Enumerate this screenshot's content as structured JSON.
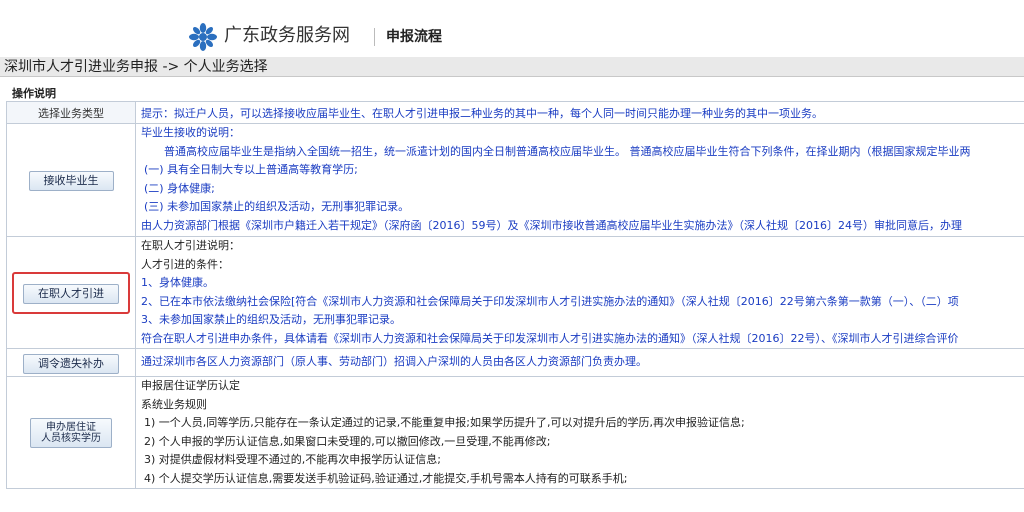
{
  "header": {
    "site_name": "广东政务服务网",
    "page_title": "申报流程"
  },
  "breadcrumb": "深圳市人才引进业务申报 -> 个人业务选择",
  "section_title": "操作说明",
  "table": {
    "head": {
      "left": "选择业务类型",
      "right": "提示：拟迁户人员，可以选择接收应届毕业生、在职人才引进申报二种业务的其中一种，每个人同一时间只能办理一种业务的其中一项业务。"
    },
    "rows": [
      {
        "button": "接收毕业生",
        "lines": [
          {
            "text": "毕业生接收的说明：",
            "cls": ""
          },
          {
            "text": "普通高校应届毕业生是指纳入全国统一招生，统一派遣计划的国内全日制普通高校应届毕业生。 普通高校应届毕业生符合下列条件，在择业期内（根据国家规定毕业两",
            "cls": "ind"
          },
          {
            "text": "(一) 具有全日制大专以上普通高等教育学历;",
            "cls": "ind2"
          },
          {
            "text": "(二) 身体健康;",
            "cls": "ind2"
          },
          {
            "text": "(三) 未参加国家禁止的组织及活动，无刑事犯罪记录。",
            "cls": "ind2"
          },
          {
            "text": "由人力资源部门根据《深圳市户籍迁入若干规定》（深府函〔2016〕59号）及《深圳市接收普通高校应届毕业生实施办法》（深人社规〔2016〕24号）审批同意后，办理",
            "cls": ""
          }
        ]
      },
      {
        "button": "在职人才引进",
        "lines": [
          {
            "text": "在职人才引进说明：",
            "cls": "dark"
          },
          {
            "text": "人才引进的条件：",
            "cls": "dark"
          },
          {
            "text": "1、身体健康。",
            "cls": ""
          },
          {
            "text": "2、已在本市依法缴纳社会保险[符合《深圳市人力资源和社会保障局关于印发深圳市人才引进实施办法的通知》（深人社规〔2016〕22号第六条第一款第（一）、（二）项",
            "cls": ""
          },
          {
            "text": "3、未参加国家禁止的组织及活动，无刑事犯罪记录。",
            "cls": ""
          },
          {
            "text": "符合在职人才引进申办条件，具体请看《深圳市人力资源和社会保障局关于印发深圳市人才引进实施办法的通知》（深人社规〔2016〕22号）、《深圳市人才引进综合评价",
            "cls": ""
          }
        ]
      },
      {
        "button": "调令遗失补办",
        "lines": [
          {
            "text": "通过深圳市各区人力资源部门（原人事、劳动部门）招调入户深圳的人员由各区人力资源部门负责办理。",
            "cls": ""
          }
        ]
      },
      {
        "button_lines": [
          "申办居住证",
          "人员核实学历"
        ],
        "lines": [
          {
            "text": "申报居住证学历认定",
            "cls": "dark"
          },
          {
            "text": "系统业务规则",
            "cls": "dark"
          },
          {
            "text": "1) 一个人员,同等学历,只能存在一条认定通过的记录,不能重复申报;如果学历提升了,可以对提升后的学历,再次申报验证信息;",
            "cls": "ind2 dark"
          },
          {
            "text": "2) 个人申报的学历认证信息,如果窗口未受理的,可以撤回修改,一旦受理,不能再修改;",
            "cls": "ind2 dark"
          },
          {
            "text": "3) 对提供虚假材料受理不通过的,不能再次申报学历认证信息;",
            "cls": "ind2 dark"
          },
          {
            "text": "4) 个人提交学历认证信息,需要发送手机验证码,验证通过,才能提交,手机号需本人持有的可联系手机;",
            "cls": "ind2 dark"
          }
        ]
      }
    ]
  },
  "colors": {
    "link_blue": "#1a3cc2",
    "highlight_red": "#d93a3a",
    "logo_blue": "#2b6fbf"
  }
}
